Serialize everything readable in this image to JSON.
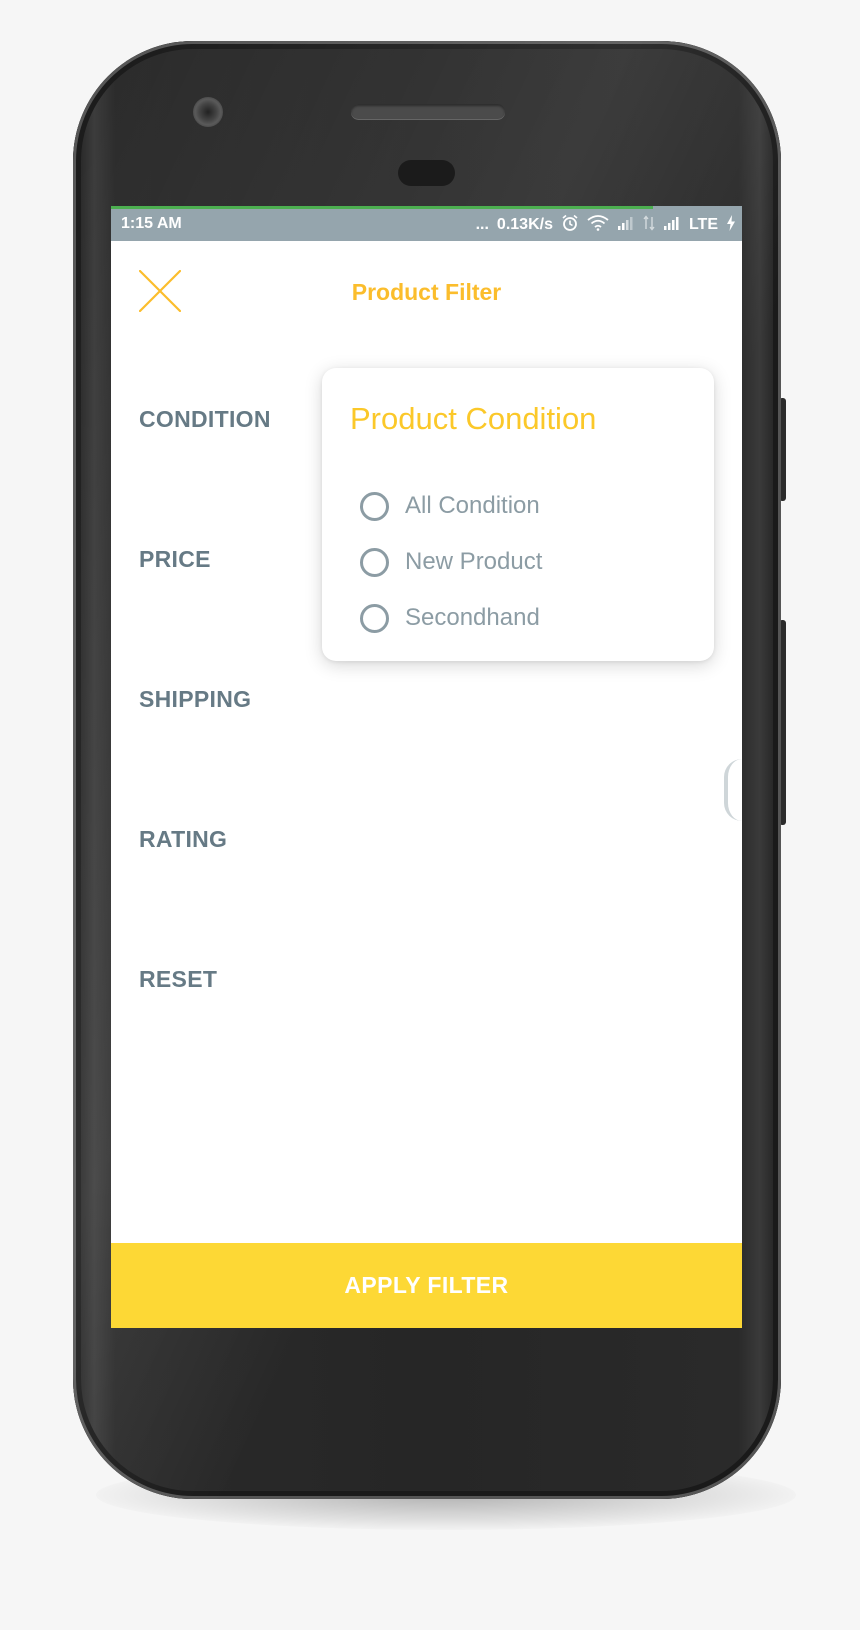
{
  "status_bar": {
    "time": "1:15 AM",
    "dots": "...",
    "speed": "0.13K/s",
    "network": "LTE",
    "icons": [
      "alarm-icon",
      "wifi-icon",
      "signal-icon",
      "data-arrows-icon",
      "signal-icon",
      "charging-icon"
    ],
    "progress_color": "#4caf50",
    "background": "#95a5ad"
  },
  "header": {
    "title": "Product Filter",
    "close_icon": "close-icon",
    "accent": "#fbbd2c"
  },
  "menu": {
    "items": [
      {
        "label": "CONDITION"
      },
      {
        "label": "PRICE"
      },
      {
        "label": "SHIPPING"
      },
      {
        "label": "RATING"
      },
      {
        "label": "RESET"
      }
    ],
    "color": "#667a85"
  },
  "condition_popup": {
    "title": "Product Condition",
    "options": [
      {
        "label": "All Condition",
        "selected": false
      },
      {
        "label": "New Product",
        "selected": false
      },
      {
        "label": "Secondhand",
        "selected": false
      }
    ],
    "title_color": "#fbc829"
  },
  "footer": {
    "apply_label": "APPLY FILTER",
    "background": "#fdd835"
  }
}
